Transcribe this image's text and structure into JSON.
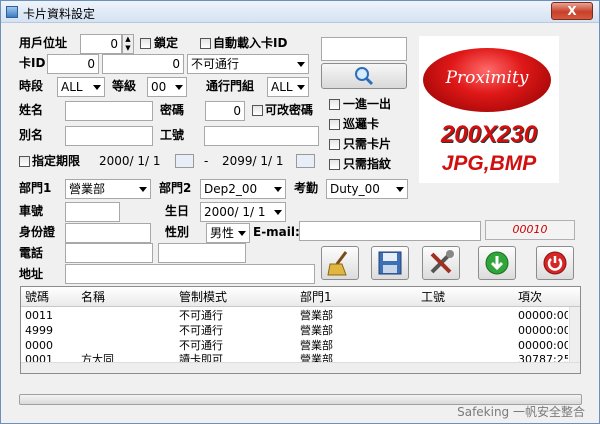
{
  "window": {
    "title": "卡片資料設定",
    "close": "X"
  },
  "form": {
    "user_address_label": "用戶位址",
    "user_address_value": "0",
    "lock_label": "鎖定",
    "auto_load_label": "自動載入卡ID",
    "card_id_label": "卡ID",
    "card_id_value": "0",
    "card_id_value2": "0",
    "access_combo": "不可通行",
    "period_label": "時段",
    "period_value": "ALL",
    "level_label": "等級",
    "level_value": "00",
    "group_label": "通行門組",
    "group_value": "ALL",
    "name_label": "姓名",
    "password_label": "密碼",
    "password_value": "0",
    "change_password_label": "可改密碼",
    "alias_label": "別名",
    "employee_no_label": "工號",
    "expiry_label": "指定期限",
    "date_start": "2000/ 1/ 1",
    "date_sep": "-",
    "date_end": "2099/ 1/ 1",
    "dept1_label": "部門1",
    "dept1_value": "營業部",
    "dept2_label": "部門2",
    "dept2_value": "Dep2_00",
    "attendance_label": "考勤",
    "attendance_value": "Duty_00",
    "plate_label": "車號",
    "birthday_label": "生日",
    "birthday_value": "2000/ 1/ 1",
    "id_label": "身份證",
    "gender_label": "性別",
    "gender_value": "男性",
    "email_label": "E-mail:",
    "phone_label": "電話",
    "address_label": "地址"
  },
  "options": {
    "one_in_one_out": "一進一出",
    "patrol_card": "巡邏卡",
    "card_only": "只需卡片",
    "fingerprint_only": "只需指紋"
  },
  "logo": {
    "brand": "Proximity",
    "size": "200X230",
    "formats": "JPG,BMP"
  },
  "card_display": "00010",
  "icons": [
    "search-icon",
    "broom-icon",
    "save-icon",
    "tools-icon",
    "download-icon",
    "power-icon"
  ],
  "table": {
    "columns": [
      "號碼",
      "名稱",
      "管制模式",
      "部門1",
      "工號",
      "項次"
    ],
    "rows": [
      [
        "0011",
        "",
        "不可通行",
        "營業部",
        "",
        "00000:00("
      ],
      [
        "4999",
        "",
        "不可通行",
        "營業部",
        "",
        "00000:00("
      ],
      [
        "0000",
        "",
        "不可通行",
        "營業部",
        "",
        "00000:00("
      ],
      [
        "0001",
        "方大同",
        "讀卡即可",
        "營業部",
        "",
        "30787:25("
      ]
    ]
  },
  "footer": "Safeking 一帆安全整合",
  "colors": {
    "card_display_text": "#cc0000",
    "logo_red": "#d20f0f"
  }
}
